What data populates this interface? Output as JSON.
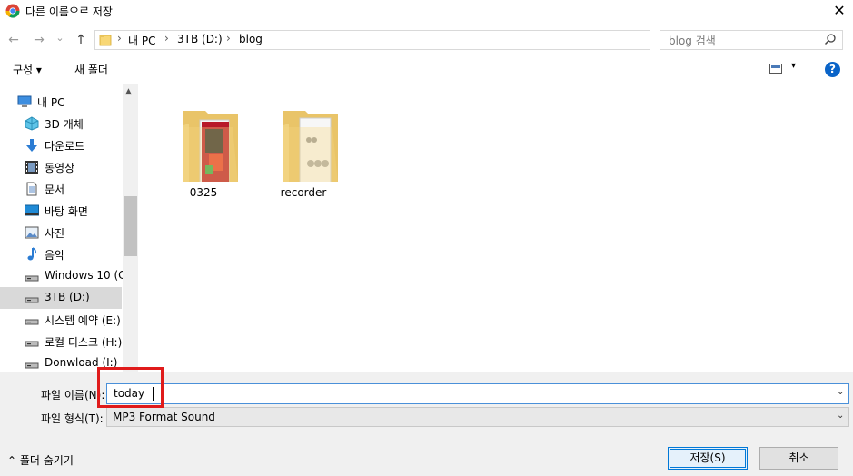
{
  "window": {
    "title": "다른 이름으로 저장",
    "close_glyph": "✕",
    "icon": "chrome-icon"
  },
  "nav": {
    "back": "←",
    "forward": "→",
    "recent": "⌄",
    "up": "↑",
    "breadcrumb": [
      "내 PC",
      "3TB (D:)",
      "blog"
    ],
    "separator": "›",
    "dropdown": "⌄",
    "refresh": "↻",
    "search_placeholder": "blog 검색"
  },
  "toolbar": {
    "organize_label": "구성 ▾",
    "new_folder_label": "새 폴더",
    "view_dropdown": "▾",
    "help": "?"
  },
  "sidebar": {
    "items": [
      {
        "label": "내 PC",
        "icon": "computer-icon"
      },
      {
        "label": "3D 개체",
        "icon": "3d-objects-icon"
      },
      {
        "label": "다운로드",
        "icon": "download-icon"
      },
      {
        "label": "동영상",
        "icon": "video-icon"
      },
      {
        "label": "문서",
        "icon": "document-icon"
      },
      {
        "label": "바탕 화면",
        "icon": "desktop-icon"
      },
      {
        "label": "사진",
        "icon": "pictures-icon"
      },
      {
        "label": "음악",
        "icon": "music-icon"
      },
      {
        "label": "Windows 10 (C:",
        "icon": "drive-icon"
      },
      {
        "label": "3TB (D:)",
        "icon": "drive-icon",
        "selected": true
      },
      {
        "label": "시스템 예약 (E:)",
        "icon": "drive-icon"
      },
      {
        "label": "로컬 디스크 (H:)",
        "icon": "drive-icon"
      },
      {
        "label": "Donwload (I:)",
        "icon": "drive-icon"
      }
    ]
  },
  "files": [
    {
      "name": "0325",
      "icon": "folder-icon"
    },
    {
      "name": "recorder",
      "icon": "folder-icon"
    }
  ],
  "form": {
    "filename_label": "파일 이름(N):",
    "filename_value": "today",
    "filetype_label": "파일 형식(T):",
    "filetype_value": "MP3 Format Sound",
    "dropdown": "⌄"
  },
  "footer": {
    "hide_folders": "⌃  폴더 숨기기",
    "save_label": "저장(S)",
    "cancel_label": "취소"
  },
  "colors": {
    "accent": "#0078d7",
    "highlight_box": "#e01b1b",
    "selected_bg": "#d9d9d9",
    "bottom_bg": "#f0f0f0"
  }
}
